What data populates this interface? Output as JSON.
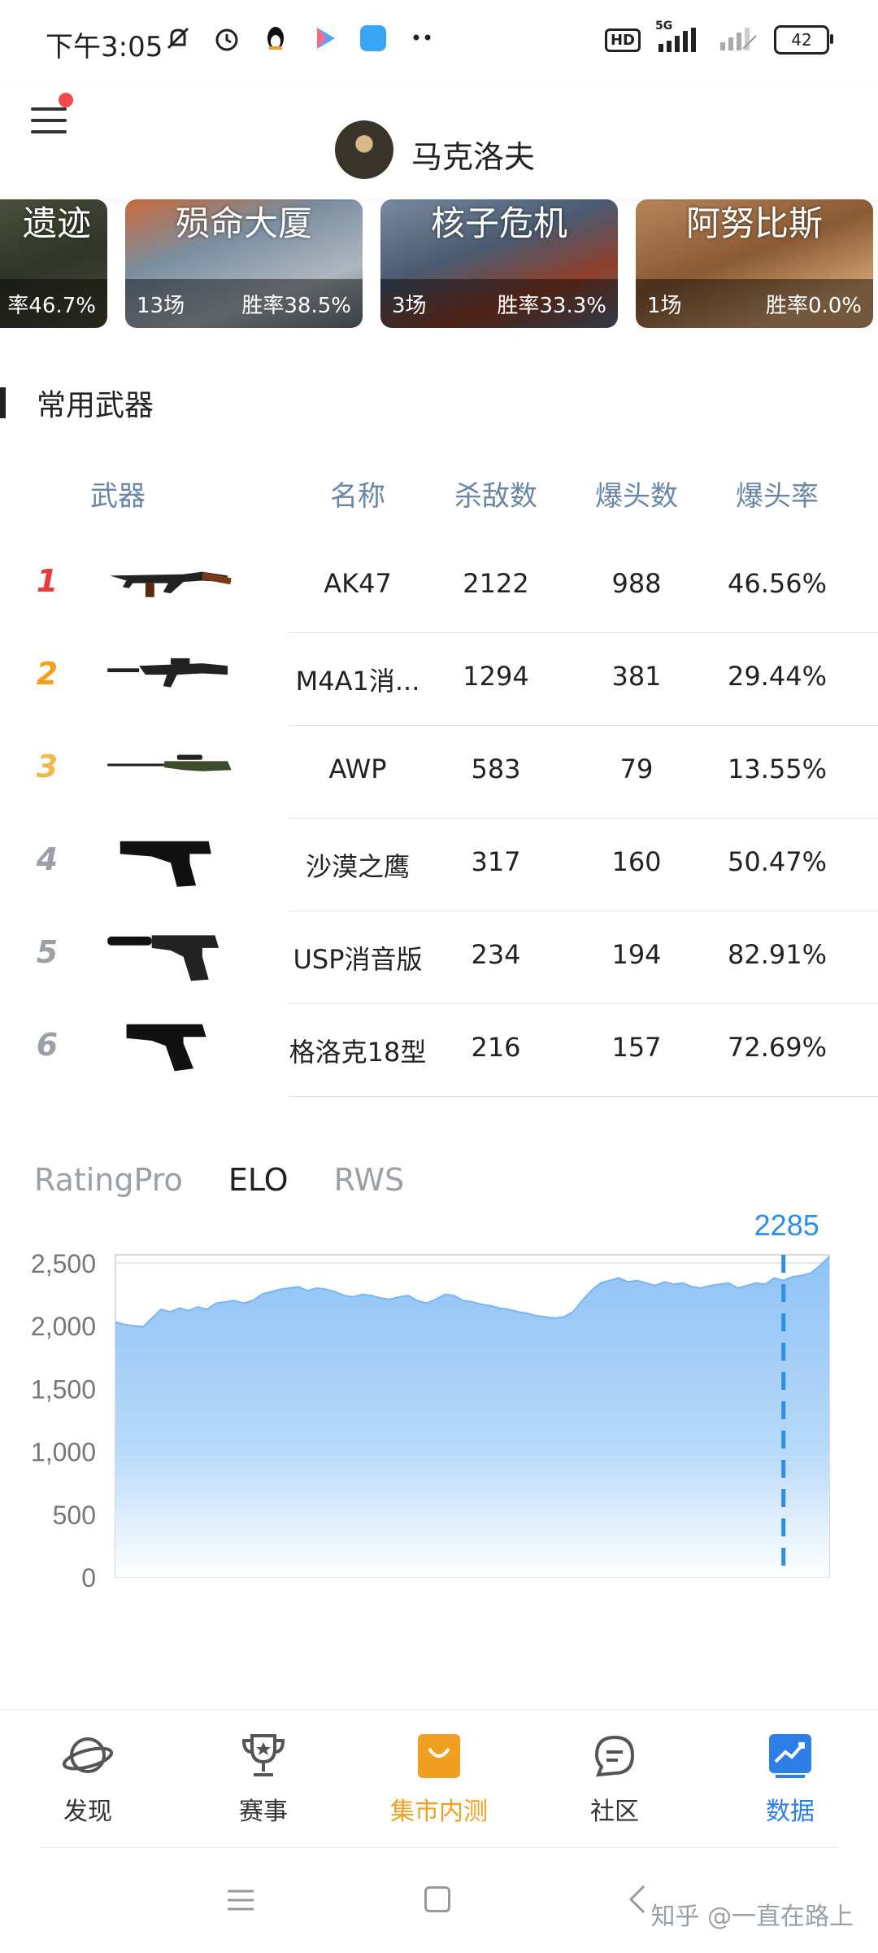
{
  "status_bar": {
    "time": "下午3:05",
    "network": "5G",
    "hd": "HD",
    "battery": "42"
  },
  "header": {
    "username": "马克洛夫"
  },
  "maps": [
    {
      "name": "遗迹",
      "matches": "",
      "winrate": "率46.7%"
    },
    {
      "name": "殒命大厦",
      "matches": "13场",
      "winrate": "胜率38.5%"
    },
    {
      "name": "核子危机",
      "matches": "3场",
      "winrate": "胜率33.3%"
    },
    {
      "name": "阿努比斯",
      "matches": "1场",
      "winrate": "胜率0.0%"
    }
  ],
  "weapons_section": {
    "title": "常用武器",
    "headers": {
      "weapon": "武器",
      "name": "名称",
      "kills": "杀敌数",
      "headshots": "爆头数",
      "hs_rate": "爆头率"
    },
    "rows": [
      {
        "rank": "1",
        "icon": "ak47-gun-icon",
        "name": "AK47",
        "kills": "2122",
        "headshots": "988",
        "hs_rate": "46.56%"
      },
      {
        "rank": "2",
        "icon": "m4a1-gun-icon",
        "name": "M4A1消...",
        "kills": "1294",
        "headshots": "381",
        "hs_rate": "29.44%"
      },
      {
        "rank": "3",
        "icon": "awp-gun-icon",
        "name": "AWP",
        "kills": "583",
        "headshots": "79",
        "hs_rate": "13.55%"
      },
      {
        "rank": "4",
        "icon": "desert-eagle-gun-icon",
        "name": "沙漠之鹰",
        "kills": "317",
        "headshots": "160",
        "hs_rate": "50.47%"
      },
      {
        "rank": "5",
        "icon": "usp-gun-icon",
        "name": "USP消音版",
        "kills": "234",
        "headshots": "194",
        "hs_rate": "82.91%"
      },
      {
        "rank": "6",
        "icon": "glock-gun-icon",
        "name": "格洛克18型",
        "kills": "216",
        "headshots": "157",
        "hs_rate": "72.69%"
      }
    ]
  },
  "rating_tabs": [
    {
      "label": "RatingPro",
      "active": false
    },
    {
      "label": "ELO",
      "active": true
    },
    {
      "label": "RWS",
      "active": false
    }
  ],
  "chart_data": {
    "type": "area",
    "ylim": [
      0,
      2500
    ],
    "yticks": [
      "2,500",
      "2,000",
      "1,500",
      "1,000",
      "500",
      "0"
    ],
    "grid": true,
    "highlight_label": "2285",
    "series": [
      {
        "values": [
          2030,
          2010,
          2000,
          1990,
          2060,
          2130,
          2110,
          2140,
          2120,
          2150,
          2130,
          2180,
          2190,
          2200,
          2180,
          2200,
          2250,
          2270,
          2290,
          2300,
          2310,
          2280,
          2300,
          2290,
          2270,
          2240,
          2230,
          2250,
          2240,
          2220,
          2210,
          2230,
          2240,
          2200,
          2180,
          2210,
          2250,
          2240,
          2200,
          2190,
          2170,
          2160,
          2140,
          2130,
          2110,
          2100,
          2080,
          2070,
          2060,
          2070,
          2110,
          2200,
          2280,
          2340,
          2360,
          2380,
          2350,
          2360,
          2340,
          2320,
          2350,
          2330,
          2340,
          2310,
          2300,
          2320,
          2330,
          2340,
          2300,
          2320,
          2340,
          2330,
          2380,
          2360,
          2390,
          2400,
          2420,
          2480,
          2550
        ]
      }
    ],
    "highlight_index": 73
  },
  "bottom_nav": [
    {
      "label": "发现",
      "icon": "planet-icon",
      "color": "#333333"
    },
    {
      "label": "赛事",
      "icon": "trophy-icon",
      "color": "#333333"
    },
    {
      "label": "集市内测",
      "icon": "shopping-bag-icon",
      "color": "#f0a020"
    },
    {
      "label": "社区",
      "icon": "chat-bubble-icon",
      "color": "#333333"
    },
    {
      "label": "数据",
      "icon": "chart-icon",
      "color": "#2d7ee6"
    }
  ],
  "watermark": "知乎 @一直在路上",
  "colors": {
    "accent_blue": "#2d7ee6",
    "accent_orange": "#f0a020",
    "chart_fill": "#8fc3f6",
    "header_blue": "#6a86a6"
  }
}
